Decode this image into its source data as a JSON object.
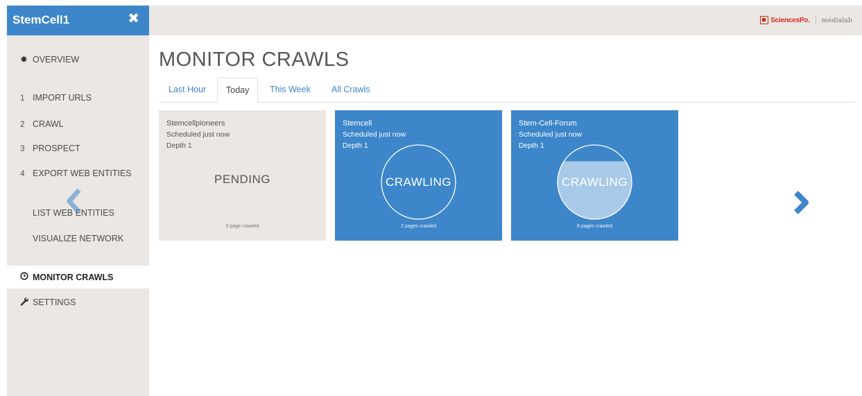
{
  "app": {
    "title": "StemCell1",
    "close_glyph": "✖"
  },
  "header": {
    "logo_sciencespo": "SciencesPo.",
    "logo_medialab": "médialab"
  },
  "sidebar": {
    "items": [
      {
        "num": "",
        "icon": "gear-icon",
        "glyph": "✸",
        "label": "OVERVIEW"
      },
      {
        "num": "1",
        "label": "IMPORT URLS"
      },
      {
        "num": "2",
        "label": "CRAWL"
      },
      {
        "num": "3",
        "label": "PROSPECT"
      },
      {
        "num": "4",
        "label": "EXPORT WEB ENTITIES"
      },
      {
        "num": "",
        "label": "LIST WEB ENTITIES"
      },
      {
        "num": "",
        "label": "VISUALIZE NETWORK"
      },
      {
        "num": "",
        "icon": "clock-icon",
        "glyph": "⊙",
        "label": "MONITOR CRAWLS",
        "active": true
      },
      {
        "num": "",
        "icon": "wrench-icon",
        "glyph": "🔧",
        "label": "SETTINGS"
      }
    ]
  },
  "main": {
    "title": "MONITOR CRAWLS",
    "tabs": [
      {
        "label": "Last Hour"
      },
      {
        "label": "Today",
        "active": true
      },
      {
        "label": "This Week"
      },
      {
        "label": "All Crawls"
      }
    ],
    "cards": [
      {
        "name": "Stemcellpioneers",
        "scheduled": "Scheduled just now",
        "depth": "Depth 1",
        "status": "PENDING",
        "pages": "0 page crawled",
        "progress": 0
      },
      {
        "name": "Stemcell",
        "scheduled": "Scheduled just now",
        "depth": "Depth 1",
        "status": "CRAWLING",
        "pages": "2 pages crawled",
        "progress": 0
      },
      {
        "name": "Stem-Cell-Forum",
        "scheduled": "Scheduled just now",
        "depth": "Depth 1",
        "status": "CRAWLING",
        "pages": "6 pages crawled",
        "progress": 0.78
      }
    ]
  },
  "colors": {
    "accent": "#3c86c9",
    "sidebar_bg": "#eae7e4",
    "sciencespo_red": "#d5281c"
  }
}
